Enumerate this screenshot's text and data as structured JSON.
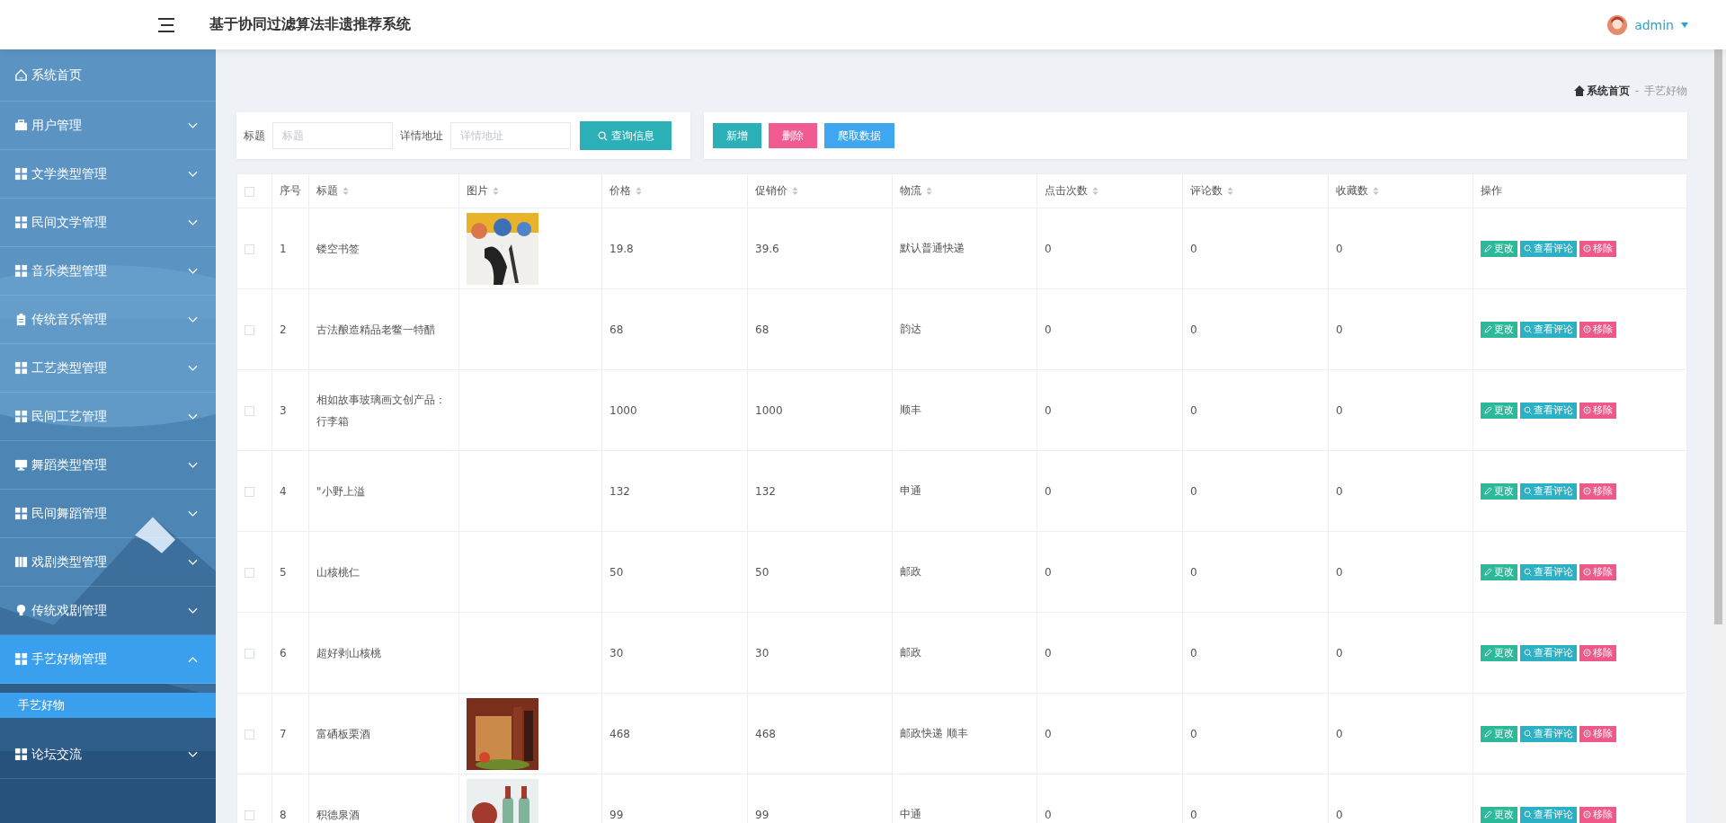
{
  "header": {
    "title": "基于协同过滤算法非遗推荐系统",
    "user": "admin"
  },
  "sidebar": {
    "items": [
      {
        "label": "系统首页"
      },
      {
        "label": "用户管理",
        "expanded": false
      },
      {
        "label": "文学类型管理",
        "expanded": false
      },
      {
        "label": "民间文学管理",
        "expanded": false
      },
      {
        "label": "音乐类型管理",
        "expanded": false
      },
      {
        "label": "传统音乐管理",
        "expanded": false
      },
      {
        "label": "工艺类型管理",
        "expanded": false
      },
      {
        "label": "民间工艺管理",
        "expanded": false
      },
      {
        "label": "舞蹈类型管理",
        "expanded": false
      },
      {
        "label": "民间舞蹈管理",
        "expanded": false
      },
      {
        "label": "戏剧类型管理",
        "expanded": false
      },
      {
        "label": "传统戏剧管理",
        "expanded": false
      },
      {
        "label": "手艺好物管理",
        "expanded": true,
        "children": [
          {
            "label": "手艺好物",
            "selected": true
          }
        ]
      },
      {
        "label": "论坛交流",
        "expanded": false
      }
    ]
  },
  "breadcrumb": [
    "系统首页",
    "-",
    "手艺好物"
  ],
  "search": {
    "fields": [
      {
        "label": "标题",
        "placeholder": "标题"
      },
      {
        "label": "详情地址",
        "placeholder": "详情地址"
      }
    ],
    "button": "查询信息"
  },
  "toolbar": [
    {
      "label": "新增",
      "kind": "add"
    },
    {
      "label": "删除",
      "kind": "delete"
    },
    {
      "label": "爬取数据",
      "kind": "crawl"
    }
  ],
  "table": {
    "columns": [
      {
        "label": "序号",
        "sortable": false
      },
      {
        "label": "标题",
        "sortable": true
      },
      {
        "label": "图片",
        "sortable": true
      },
      {
        "label": "价格",
        "sortable": true
      },
      {
        "label": "促销价",
        "sortable": true
      },
      {
        "label": "物流",
        "sortable": true
      },
      {
        "label": "点击次数",
        "sortable": true
      },
      {
        "label": "评论数",
        "sortable": true
      },
      {
        "label": "收藏数",
        "sortable": true
      },
      {
        "label": "操作",
        "sortable": false
      }
    ],
    "all_checked": false,
    "rows": [
      {
        "checked": false,
        "no": "1",
        "title": "镂空书签",
        "price": "19.8",
        "promo": "39.6",
        "shipping": "默认普通快递",
        "clicks": "0",
        "comments": "0",
        "favorites": "0",
        "actions": [
          "更改",
          "查看评论",
          "移除"
        ]
      },
      {
        "checked": false,
        "no": "2",
        "title": "古法酿造精品老鳖一特醋",
        "price": "68",
        "promo": "68",
        "shipping": "韵达",
        "clicks": "0",
        "comments": "0",
        "favorites": "0",
        "actions": [
          "更改",
          "查看评论",
          "移除"
        ]
      },
      {
        "checked": false,
        "no": "3",
        "title": "相如故事玻璃画文创产品：行李箱",
        "price": "1000",
        "promo": "1000",
        "shipping": "顺丰",
        "clicks": "0",
        "comments": "0",
        "favorites": "0",
        "actions": [
          "更改",
          "查看评论",
          "移除"
        ]
      },
      {
        "checked": false,
        "no": "4",
        "title": "\"小野上溢",
        "price": "132",
        "promo": "132",
        "shipping": "申通",
        "clicks": "0",
        "comments": "0",
        "favorites": "0",
        "actions": [
          "更改",
          "查看评论",
          "移除"
        ]
      },
      {
        "checked": false,
        "no": "5",
        "title": "山核桃仁",
        "price": "50",
        "promo": "50",
        "shipping": "邮政",
        "clicks": "0",
        "comments": "0",
        "favorites": "0",
        "actions": [
          "更改",
          "查看评论",
          "移除"
        ]
      },
      {
        "checked": false,
        "no": "6",
        "title": "超好剥山核桃",
        "price": "30",
        "promo": "30",
        "shipping": "邮政",
        "clicks": "0",
        "comments": "0",
        "favorites": "0",
        "actions": [
          "更改",
          "查看评论",
          "移除"
        ]
      },
      {
        "checked": false,
        "no": "7",
        "title": "富硒板栗酒",
        "price": "468",
        "promo": "468",
        "shipping": "邮政快递 顺丰",
        "clicks": "0",
        "comments": "0",
        "favorites": "0",
        "actions": [
          "更改",
          "查看评论",
          "移除"
        ]
      },
      {
        "checked": false,
        "no": "8",
        "title": "积德泉酒",
        "price": "99",
        "promo": "99",
        "shipping": "中通",
        "clicks": "0",
        "comments": "0",
        "favorites": "0",
        "actions": [
          "更改",
          "查看评论",
          "移除"
        ]
      }
    ]
  }
}
